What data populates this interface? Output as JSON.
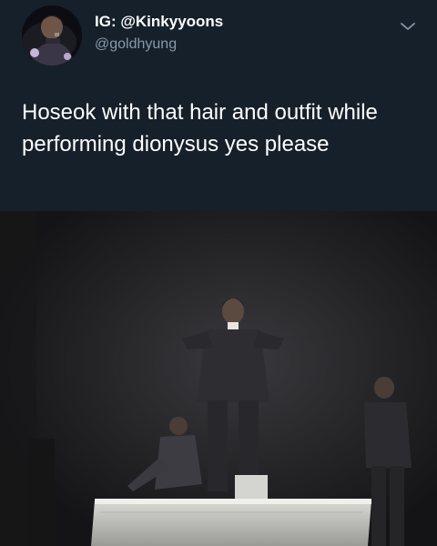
{
  "tweet": {
    "display_name": "IG: @Kinkyyoons",
    "handle": "@goldhyung",
    "text": "Hoseok with that hair and outfit while performing dionysus yes please"
  },
  "icons": {
    "menu": "chevron-down-icon",
    "avatar": "profile-photo"
  },
  "colors": {
    "background": "#15202b",
    "text": "#ffffff",
    "secondary_text": "#8899a6"
  }
}
